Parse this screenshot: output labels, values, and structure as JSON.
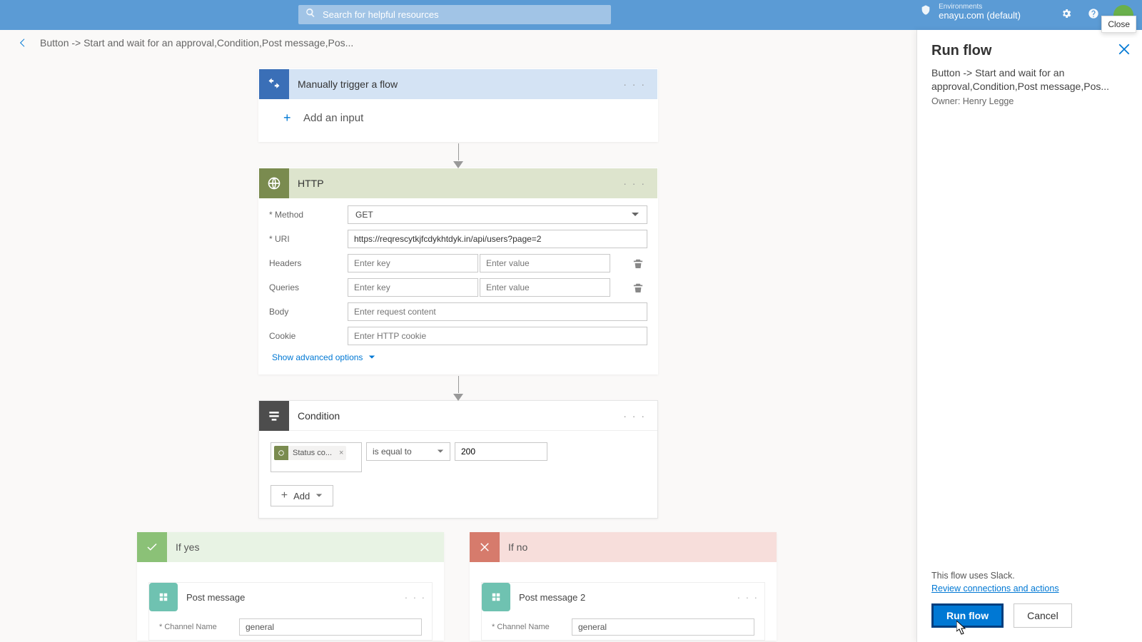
{
  "topbar": {
    "search_placeholder": "Search for helpful resources",
    "env_label": "Environments",
    "env_value": "enayu.com (default)",
    "close_tooltip": "Close"
  },
  "breadcrumb": "Button -> Start and wait for an approval,Condition,Post message,Pos...",
  "trigger": {
    "title": "Manually trigger a flow",
    "add_input": "Add an input"
  },
  "http": {
    "title": "HTTP",
    "method_label": "Method",
    "method_value": "GET",
    "uri_label": "URI",
    "uri_value": "https://reqrescytkjfcdykhtdyk.in/api/users?page=2",
    "headers_label": "Headers",
    "queries_label": "Queries",
    "key_placeholder": "Enter key",
    "val_placeholder": "Enter value",
    "body_label": "Body",
    "body_placeholder": "Enter request content",
    "cookie_label": "Cookie",
    "cookie_placeholder": "Enter HTTP cookie",
    "advanced": "Show advanced options"
  },
  "condition": {
    "title": "Condition",
    "token_label": "Status co...",
    "operator": "is equal to",
    "value": "200",
    "add": "Add"
  },
  "branches": {
    "yes_label": "If yes",
    "no_label": "If no",
    "post1_title": "Post message",
    "post2_title": "Post message 2",
    "channel_label": "Channel Name",
    "channel_value": "general"
  },
  "panel": {
    "title": "Run flow",
    "subtitle": "Button -> Start and wait for an approval,Condition,Post message,Pos...",
    "owner": "Owner: Henry Legge",
    "note": "This flow uses Slack.",
    "link": "Review connections and actions",
    "run": "Run flow",
    "cancel": "Cancel"
  }
}
